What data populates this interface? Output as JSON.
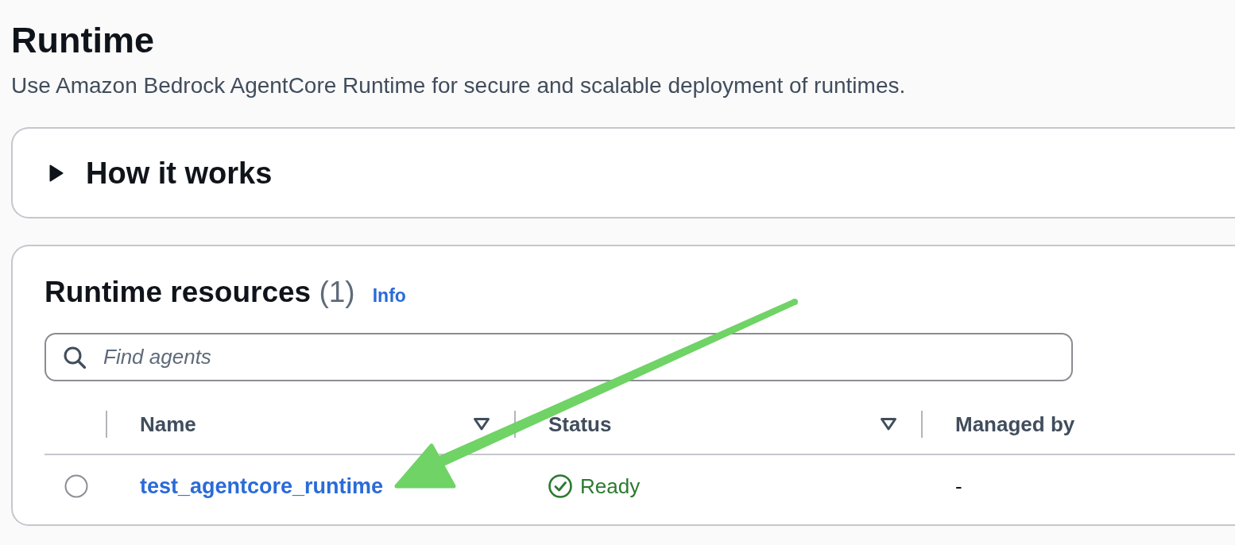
{
  "page": {
    "title": "Runtime",
    "description": "Use Amazon Bedrock AgentCore Runtime for secure and scalable deployment of runtimes."
  },
  "how_it_works": {
    "title": "How it works",
    "expanded": false
  },
  "resources": {
    "title": "Runtime resources",
    "count": "(1)",
    "info_link": "Info",
    "search": {
      "placeholder": "Find agents"
    },
    "table": {
      "columns": [
        {
          "label": "Name",
          "sortable": true
        },
        {
          "label": "Status",
          "sortable": true
        },
        {
          "label": "Managed by",
          "sortable": false
        }
      ],
      "rows": [
        {
          "selected": false,
          "name": "test_agentcore_runtime",
          "status": {
            "kind": "success",
            "label": "Ready"
          },
          "managed_by": "-"
        }
      ]
    }
  },
  "overlays": [
    {
      "kind": "arrow"
    }
  ]
}
